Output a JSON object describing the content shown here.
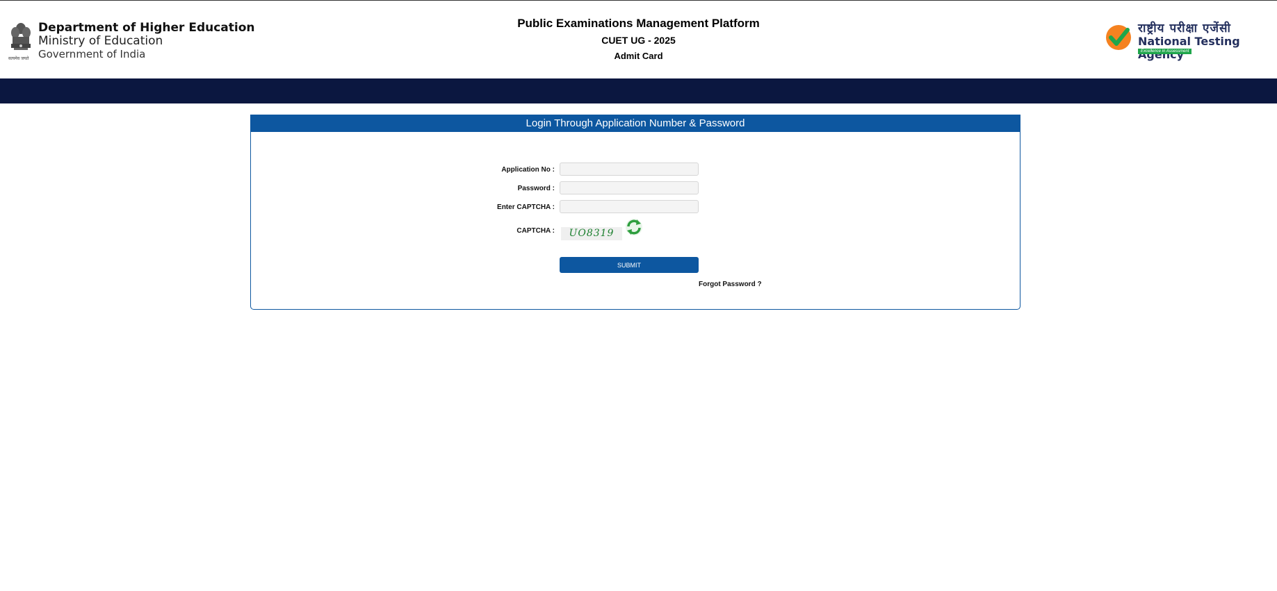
{
  "header": {
    "dept_line1": "Department of Higher Education",
    "dept_line2": "Ministry of Education",
    "dept_line3": "Government of India",
    "emblem_caption": "सत्यमेव जयते",
    "title": "Public Examinations Management Platform",
    "subtitle": "CUET UG - 2025",
    "page_name": "Admit Card",
    "nta_hindi": "राष्ट्रीय परीक्षा एजेंसी",
    "nta_english": "National Testing Agency",
    "nta_tagline": "Excellence in Assessment"
  },
  "login": {
    "heading": "Login Through Application Number & Password",
    "application_label": "Application No :",
    "application_value": "",
    "password_label": "Password :",
    "password_value": "",
    "enter_captcha_label": "Enter CAPTCHA :",
    "enter_captcha_value": "",
    "captcha_label": "CAPTCHA :",
    "captcha_text": "UO8319",
    "submit_label": "SUBMIT",
    "forgot_label": "Forgot Password ?"
  },
  "colors": {
    "primary": "#0d57a0",
    "navbar": "#0b1740",
    "nta_green": "#1fa64b",
    "nta_orange": "#f58220"
  },
  "icons": {
    "emblem": "national-emblem-icon",
    "refresh": "refresh-captcha-icon",
    "nta": "nta-checkmark-logo"
  }
}
